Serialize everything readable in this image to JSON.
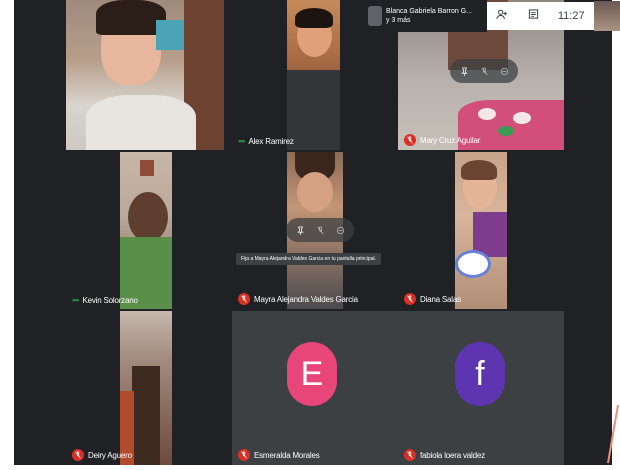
{
  "presentation": {
    "presenter": "Blanca Gabriela Barron G...",
    "others": "y 3 más"
  },
  "topbar": {
    "time": "11:27"
  },
  "tooltip": "Fija a Mayra Alejandra Valdes Garcia en tu pantalla principal.",
  "tiles": [
    {
      "id": "t1",
      "name": "",
      "muted": false
    },
    {
      "id": "t2",
      "name": "Alex Ramirez",
      "muted": false,
      "speaking": true
    },
    {
      "id": "t3",
      "name": "Mary Cruz Aguilar",
      "muted": true
    },
    {
      "id": "t4",
      "name": "Kevin Solorzano",
      "muted": false,
      "speaking": true
    },
    {
      "id": "t5",
      "name": "Mayra Alejandra Valdes Garcia",
      "muted": true
    },
    {
      "id": "t6",
      "name": "Diana Salas",
      "muted": true
    },
    {
      "id": "t7",
      "name": "Deiry Aguero",
      "muted": true
    },
    {
      "id": "t8",
      "name": "Esmeralda Morales",
      "muted": true,
      "initial": "E",
      "avatar_color": "#e8467a"
    },
    {
      "id": "t9",
      "name": "fabiola loera valdez",
      "muted": true,
      "initial": "f",
      "avatar_color": "#5e35b1"
    }
  ],
  "icons": [
    "people-icon",
    "chat-icon",
    "pin-icon",
    "mute-icon",
    "remove-icon",
    "mic-off-icon"
  ]
}
